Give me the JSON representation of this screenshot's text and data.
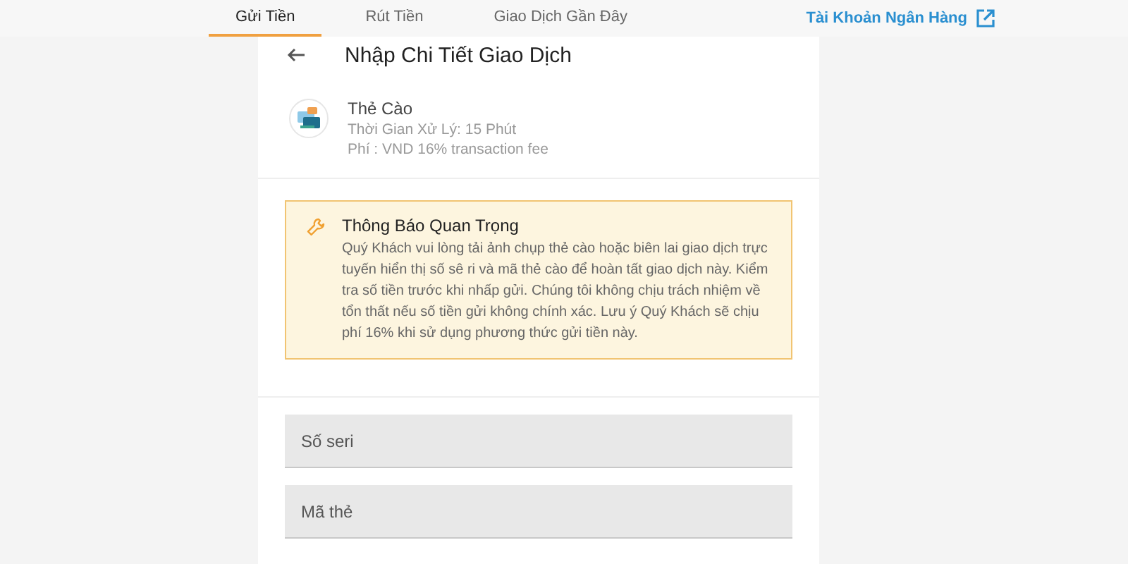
{
  "tabs": [
    {
      "label": "Gửi Tiền",
      "selected": true
    },
    {
      "label": "Rút Tiền",
      "selected": false
    },
    {
      "label": "Giao Dịch Gần Đây",
      "selected": false
    }
  ],
  "bank_link": {
    "label": "Tài Khoản Ngân Hàng"
  },
  "card": {
    "title": "Nhập Chi Tiết Giao Dịch",
    "method": {
      "name": "Thẻ Cào",
      "processing_time": "Thời Gian Xử Lý: 15 Phút",
      "fee": "Phí : VND 16% transaction fee"
    },
    "notice": {
      "title": "Thông Báo Quan Trọng",
      "text": "Quý Khách vui lòng tải ảnh chụp thẻ cào hoặc biên lai giao dịch trực tuyến hiển thị số sê ri và mã thẻ cào để hoàn tất giao dịch này. Kiểm tra số tiền trước khi nhấp gửi. Chúng tôi không chịu trách nhiệm về tổn thất nếu số tiền gửi không chính xác. Lưu ý Quý Khách sẽ chịu phí 16% khi sử dụng phương thức gửi tiền này."
    },
    "fields": [
      {
        "placeholder": "Số seri"
      },
      {
        "placeholder": "Mã thẻ"
      }
    ]
  }
}
